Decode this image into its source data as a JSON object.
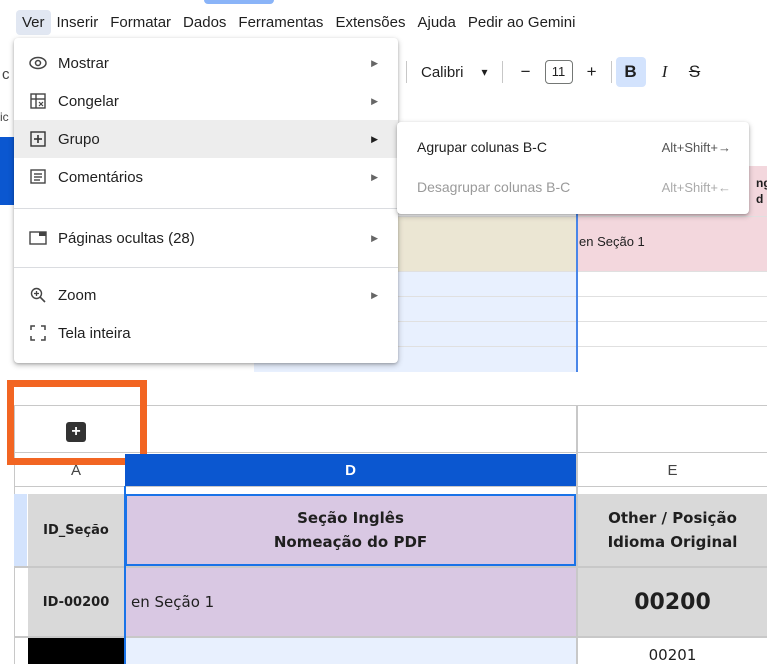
{
  "menubar": {
    "items": [
      "Ver",
      "Inserir",
      "Formatar",
      "Dados",
      "Ferramentas",
      "Extensões",
      "Ajuda",
      "Pedir ao Gemini"
    ],
    "active_index": 0
  },
  "toolbar": {
    "font": "Calibri",
    "font_dropdown_icon": "▾",
    "minus": "−",
    "size": "11",
    "plus": "+",
    "bold": "B",
    "italic": "I",
    "strike": "S"
  },
  "background": {
    "left_fragment_1": "c",
    "left_fragment_2": "ic",
    "pink_text": "en Seção 1",
    "pink_trunc": "ngl\nd do"
  },
  "view_menu": {
    "items": [
      {
        "icon": "eye-icon",
        "label": "Mostrar",
        "has_submenu": true
      },
      {
        "icon": "freeze-icon",
        "label": "Congelar",
        "has_submenu": true
      },
      {
        "icon": "group-icon",
        "label": "Grupo",
        "has_submenu": true,
        "highlighted": true
      },
      {
        "icon": "comments-icon",
        "label": "Comentários",
        "has_submenu": true
      },
      {
        "icon": "hidden-sheets-icon",
        "label": "Páginas ocultas (28)",
        "has_submenu": true
      },
      {
        "icon": "zoom-icon",
        "label": "Zoom",
        "has_submenu": true
      },
      {
        "icon": "fullscreen-icon",
        "label": "Tela inteira",
        "has_submenu": false
      }
    ]
  },
  "group_submenu": {
    "items": [
      {
        "label": "Agrupar colunas B-C",
        "shortcut": "Alt+Shift+→",
        "enabled": true
      },
      {
        "label": "Desagrupar colunas B-C",
        "shortcut": "Alt+Shift+←",
        "enabled": false
      }
    ]
  },
  "sheet": {
    "group_toggle": "+",
    "columns": {
      "a": "A",
      "d": "D",
      "e": "E"
    },
    "header_row": {
      "a": "ID_Seção",
      "d_line1": "Seção Inglês",
      "d_line2": "Nomeação do PDF",
      "e_line1": "Other / Posição",
      "e_line2": "Idioma Original"
    },
    "row1": {
      "a": "ID-00200",
      "d": "en Seção 1",
      "e": "00200"
    },
    "row2": {
      "e": "00201"
    }
  },
  "colors": {
    "accent_blue": "#0b57d0",
    "highlight_orange": "#f26522",
    "purple_cell": "#d9c8e3",
    "gray_cell": "#d9d9d9"
  }
}
